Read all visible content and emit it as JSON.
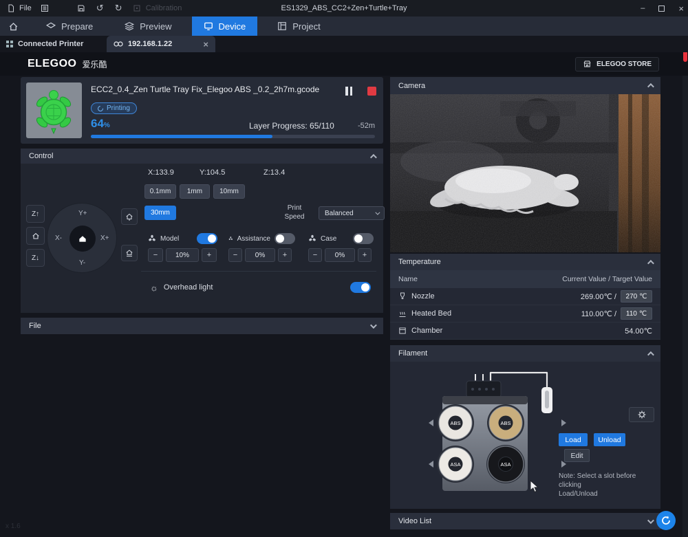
{
  "titlebar": {
    "file": "File",
    "calibration": "Calibration",
    "title": "ES1329_ABS_CC2+Zen+Turtle+Tray",
    "minimize": "–",
    "close": "×",
    "undo": "↺",
    "redo": "↻"
  },
  "nav": {
    "tabs": [
      {
        "label": "Prepare"
      },
      {
        "label": "Preview"
      },
      {
        "label": "Device"
      },
      {
        "label": "Project"
      }
    ]
  },
  "printer_bar": {
    "connected": "Connected Printer",
    "address": "192.168.1.22",
    "close": "×"
  },
  "header": {
    "brand": "ELEGOO",
    "brand_cn": "爱乐酷",
    "store": "ELEGOO STORE"
  },
  "job": {
    "filename": "ECC2_0.4_Zen Turtle Tray Fix_Elegoo ABS _0.2_2h7m.gcode",
    "status": "Printing",
    "percent": "64",
    "percent_sign": "%",
    "layer_progress": "Layer Progress: 65/110",
    "time_remaining": "-52m",
    "progress_value": 64
  },
  "control": {
    "title": "Control",
    "coord_x": "X:133.9",
    "coord_y": "Y:104.5",
    "coord_z": "Z:13.4",
    "steps": [
      "0.1mm",
      "1mm",
      "10mm"
    ],
    "step_selected": "30mm",
    "speed_label_1": "Print",
    "speed_label_2": "Speed",
    "speed_value": "Balanced",
    "jog": {
      "y_plus": "Y+",
      "y_minus": "Y-",
      "x_plus": "X+",
      "x_minus": "X-",
      "z_up": "Z↑",
      "z_down": "Z↓"
    },
    "fans": [
      {
        "label": "Model",
        "value": "10%",
        "on": true
      },
      {
        "label": "Assistance",
        "value": "0%",
        "on": false
      },
      {
        "label": "Case",
        "value": "0%",
        "on": false
      }
    ],
    "minus": "−",
    "plus": "+",
    "light_label": "Overhead light",
    "light_icon": "☼"
  },
  "file_panel": {
    "title": "File"
  },
  "camera": {
    "title": "Camera"
  },
  "temperature": {
    "title": "Temperature",
    "col_name": "Name",
    "col_value": "Current Value / Target Value",
    "rows": [
      {
        "name": "Nozzle",
        "current": "269.00℃ /",
        "target": "270",
        "unit": "℃"
      },
      {
        "name": "Heated Bed",
        "current": "110.00℃ /",
        "target": "110",
        "unit": "℃"
      },
      {
        "name": "Chamber",
        "current": "54.00℃"
      }
    ]
  },
  "filament": {
    "title": "Filament",
    "slots": [
      {
        "label": "ABS",
        "color": "#e9e6e1"
      },
      {
        "label": "ABS",
        "color": "#c9ae7d"
      },
      {
        "label": "ASA",
        "color": "#edeae5"
      },
      {
        "label": "ASA",
        "color": "#17181c"
      }
    ],
    "load": "Load",
    "unload": "Unload",
    "edit": "Edit",
    "note_line1": "Note: Select a slot before clicking",
    "note_line2": "Load/Unload"
  },
  "video_list": {
    "title": "Video List"
  },
  "footer_hint": "x 1.6"
}
